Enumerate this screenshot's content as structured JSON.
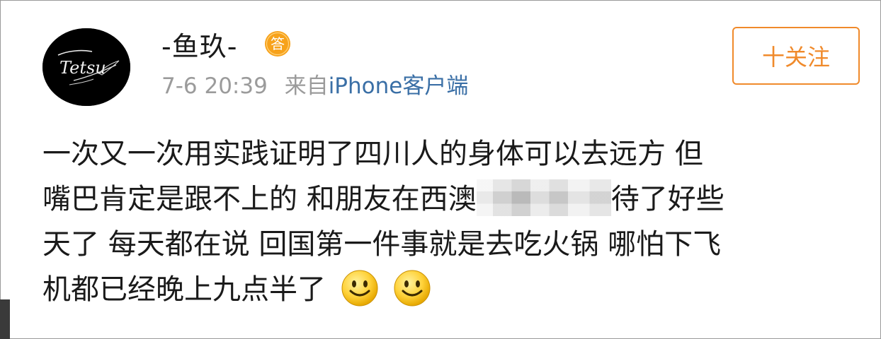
{
  "post": {
    "author": {
      "username": "-鱼玖-",
      "avatar_text": "Tetsu",
      "badge_text": "答"
    },
    "meta": {
      "time": "7-6 20:39",
      "source_prefix": "来自",
      "source": "iPhone客户端"
    },
    "follow_button_label": "十关注",
    "text_lines": [
      "一次又一次用实践证明了四川人的身体可以去远方 但",
      "嘴巴肯定是跟不上的 和朋友在西澳",
      "待了好些",
      "天了 每天都在说 回国第一件事就是去吃火锅 哪怕下飞",
      "机都已经晚上九点半了"
    ],
    "emojis": [
      "smile-emoji",
      "smile-emoji"
    ]
  },
  "colors": {
    "accent": "#f08a2b",
    "link": "#3a6fa6",
    "meta": "#9b9b9b",
    "text": "#1a1a1a"
  }
}
